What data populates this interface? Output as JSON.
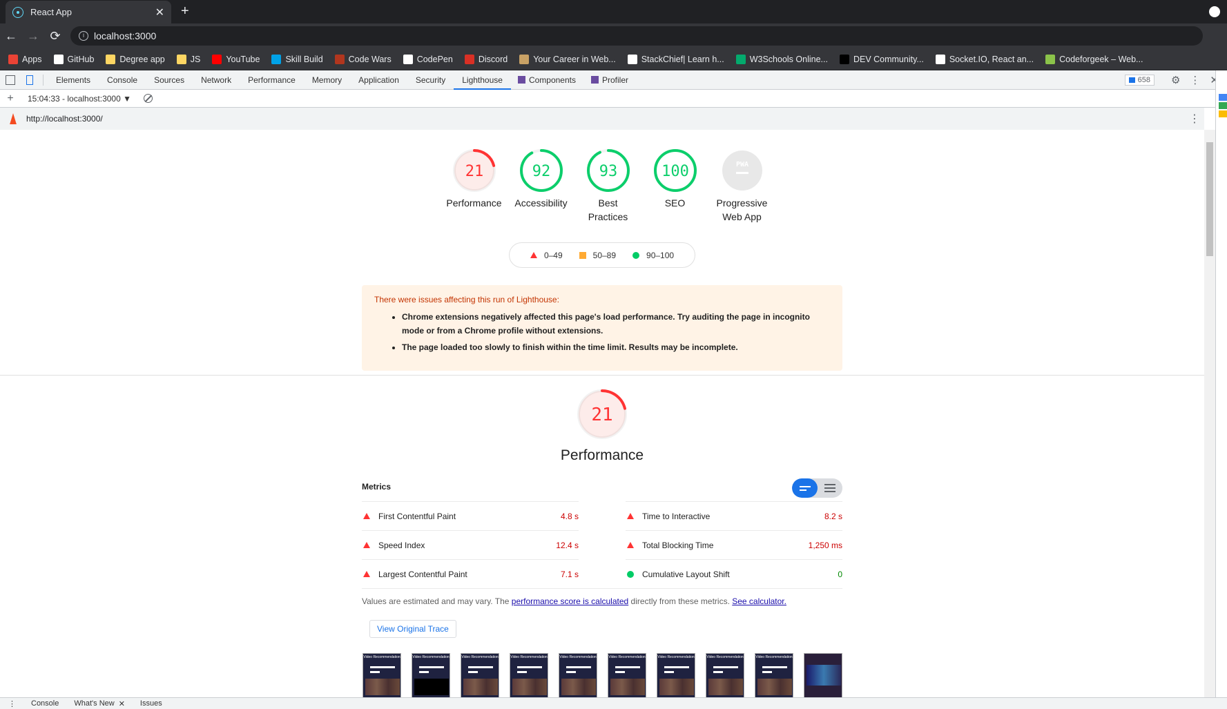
{
  "browser": {
    "tab_title": "React App",
    "tab_close": "✕",
    "new_tab": "+",
    "back": "←",
    "forward": "→",
    "reload": "⟳",
    "url": "localhost:3000"
  },
  "bookmarks": [
    {
      "label": "Apps",
      "icon": "apps-icon",
      "color": "#ea4335"
    },
    {
      "label": "GitHub",
      "icon": "github-icon",
      "color": "#ffffff"
    },
    {
      "label": "Degree app",
      "icon": "folder-icon",
      "color": "#fdd663"
    },
    {
      "label": "JS",
      "icon": "folder-icon",
      "color": "#fdd663"
    },
    {
      "label": "YouTube",
      "icon": "youtube-icon",
      "color": "#ff0000"
    },
    {
      "label": "Skill Build",
      "icon": "skillbuild-icon",
      "color": "#00a2e8"
    },
    {
      "label": "Code Wars",
      "icon": "codewars-icon",
      "color": "#b1361e"
    },
    {
      "label": "CodePen",
      "icon": "codepen-icon",
      "color": "#ffffff"
    },
    {
      "label": "Discord",
      "icon": "discord-icon",
      "color": "#d93025"
    },
    {
      "label": "Your Career in Web...",
      "icon": "career-icon",
      "color": "#c8a165"
    },
    {
      "label": "StackChief| Learn h...",
      "icon": "stackchief-icon",
      "color": "#ffffff"
    },
    {
      "label": "W3Schools Online...",
      "icon": "w3schools-icon",
      "color": "#04aa6d"
    },
    {
      "label": "DEV Community...",
      "icon": "dev-icon",
      "color": "#000000"
    },
    {
      "label": "Socket.IO, React an...",
      "icon": "socketio-icon",
      "color": "#ffffff"
    },
    {
      "label": "Codeforgeek – Web...",
      "icon": "codeforgeek-icon",
      "color": "#8bc34a"
    }
  ],
  "devtools": {
    "tabs": [
      "Elements",
      "Console",
      "Sources",
      "Network",
      "Performance",
      "Memory",
      "Application",
      "Security",
      "Lighthouse",
      "Components",
      "Profiler"
    ],
    "active_tab": "Lighthouse",
    "issues_count": "658",
    "report_selector": "15:04:33 - localhost:3000 ▼",
    "report_url": "http://localhost:3000/"
  },
  "lighthouse": {
    "categories": [
      {
        "score": "21",
        "label": "Performance",
        "fraction": 0.21,
        "color": "#ff3333",
        "bg": "#fdecea"
      },
      {
        "score": "92",
        "label": "Accessibility",
        "fraction": 0.92,
        "color": "#0cce6b",
        "bg": "#ffffff"
      },
      {
        "score": "93",
        "label": "Best Practices",
        "fraction": 0.93,
        "color": "#0cce6b",
        "bg": "#ffffff"
      },
      {
        "score": "100",
        "label": "SEO",
        "fraction": 1.0,
        "color": "#0cce6b",
        "bg": "#ffffff"
      },
      {
        "score": "PWA",
        "label": "Progressive Web App",
        "fraction": 0,
        "color": "#9e9e9e",
        "bg": "#e8e8e8"
      }
    ],
    "legend": {
      "fail": "0–49",
      "average": "50–89",
      "pass": "90–100"
    },
    "warning_title": "There were issues affecting this run of Lighthouse:",
    "warnings": [
      "Chrome extensions negatively affected this page's load performance. Try auditing the page in incognito mode or from a Chrome profile without extensions.",
      "The page loaded too slowly to finish within the time limit. Results may be incomplete."
    ],
    "performance": {
      "score": "21",
      "fraction": 0.21,
      "title": "Performance",
      "metrics_label": "Metrics",
      "metrics": [
        {
          "name": "First Contentful Paint",
          "value": "4.8 s",
          "status": "fail"
        },
        {
          "name": "Time to Interactive",
          "value": "8.2 s",
          "status": "fail"
        },
        {
          "name": "Speed Index",
          "value": "12.4 s",
          "status": "fail"
        },
        {
          "name": "Total Blocking Time",
          "value": "1,250 ms",
          "status": "fail"
        },
        {
          "name": "Largest Contentful Paint",
          "value": "7.1 s",
          "status": "fail"
        },
        {
          "name": "Cumulative Layout Shift",
          "value": "0",
          "status": "pass"
        }
      ],
      "note_prefix": "Values are estimated and may vary. The ",
      "note_link1": "performance score is calculated",
      "note_middle": " directly from these metrics. ",
      "note_link2": "See calculator.",
      "trace_button": "View Original Trace",
      "filmstrip_title": "Video Recommendation"
    }
  },
  "drawer": {
    "tabs": [
      "Console",
      "What's New",
      "Issues"
    ],
    "close": "✕"
  }
}
